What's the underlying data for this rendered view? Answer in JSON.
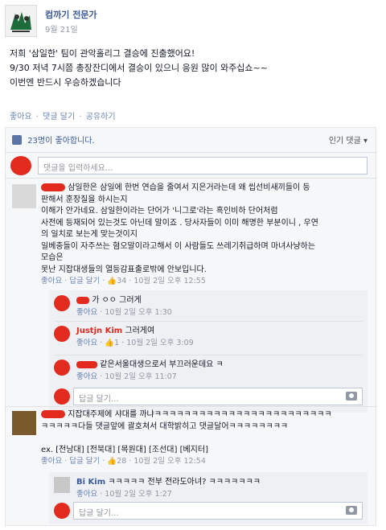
{
  "post": {
    "author": "컴까기 전문가",
    "date": "9월 21일",
    "lines": [
      "저희 '삼일한' 팀이 관악홀리그 결승에 진출했어요!",
      "9/30 저녁 7시쯤 총장잔디에서 결승이 있으니 응원 많이 와주십쇼~~",
      "이번엔 반드시 우승하겠습니다"
    ],
    "actions": {
      "like": "좋아요",
      "comment": "댓글 달기",
      "share": "공유하기",
      "sep": "·"
    }
  },
  "likes": {
    "text": "23명이 좋아합니다.",
    "sort": "인기 댓글 ▾"
  },
  "comment_input": {
    "placeholder": "댓글을 입력하세요..."
  },
  "comments": [
    {
      "name": "",
      "lines": [
        "삼일한은 삼일에 한번 연습을 줄여서 지은거라는데 왜 씹선비새끼들이 등",
        "판해서 훈장질을 하시는지",
        "이해가 안가네요. 삼일한이라는 단어가 '니그로'라는 흑인비하 단어처럼",
        "사전에 등재되어 있는것도 아닌데 말이죠 . 당사자들이 이미 해명한 부분이니 , 우연",
        "의 일치로 보는게 맞는것이지",
        "일베충들이 자주쓰는 혐오말이라고해서 이 사람들도 쓰레기취급하며 마녀사냥하는",
        "모습은",
        "못난 지잡대생들의 열등감표출로밖에 안보입니다."
      ],
      "meta": {
        "like": "좋아요",
        "reply": "답글 달기",
        "count": "34",
        "date": "10월 2일 오후 12:55"
      },
      "replies": [
        {
          "name": "",
          "text": "가 ㅇㅇ 그러게",
          "meta": {
            "like": "좋아요",
            "date": "10월 2일 오후 1:30"
          }
        },
        {
          "name": "Justjn Kim",
          "text": "그러게여",
          "meta": {
            "like": "좋아요",
            "count": "1",
            "date": "10월 2일 오후 3:09"
          }
        },
        {
          "name": "",
          "text": "같은서울대생으로서 부끄러운데요 ㅋ",
          "meta": {
            "like": "좋아요",
            "date": "10월 2일 오후 11:07"
          }
        }
      ],
      "reply_placeholder": "답글 달기..."
    },
    {
      "name": "",
      "lines": [
        "지잡대주제에 샤대를 까냐ㅋㅋㅋㅋㅋㅋㅋㅋㅋㅋㅋㅋㅋㅋㅋㅋㅋㅋㅋㅋㅋㅋㅋㅋ",
        "ㅋㅋㅋㅋㅋ다들 댓글앞에 괄호쳐서 대학밝히고 댓글달어ㅋㅋㅋㅋㅋㅋㅋㅋ",
        "",
        "ex. [전남대] [전북대] [목원대] [조선대] [베지터]"
      ],
      "meta": {
        "like": "좋아요",
        "reply": "답글 달기",
        "count": "28",
        "date": "10월 2일 오후 12:54"
      },
      "replies": [
        {
          "name": "Bi     Kim",
          "text": "ㅋㅋㅋㅋㅋ 전부 전라도아녀? ㅋㅋㅋㅋㅋㅋㅋ",
          "meta": {
            "like": "좋아요",
            "date": "10월 2일 오후 1:27"
          }
        }
      ],
      "reply_placeholder": "답글 달기..."
    }
  ],
  "colors": {
    "link": "#3b5998",
    "meta": "#9197a3",
    "redact": "#e22a1f",
    "panel": "#f6f7f9"
  },
  "icons": [
    "thumbs-up-icon",
    "camera-icon",
    "logo-icon"
  ]
}
